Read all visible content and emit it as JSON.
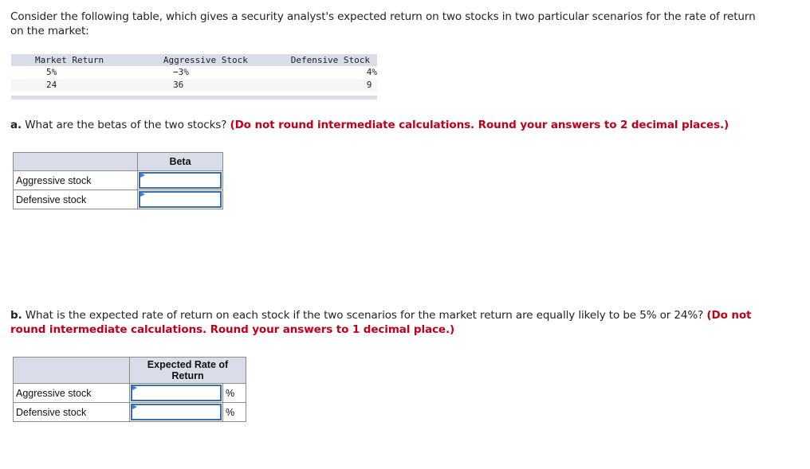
{
  "intro": "Consider the following table, which gives a security analyst's expected return on two stocks in two particular scenarios for the rate of return on the market:",
  "market_table": {
    "headers": [
      "Market Return",
      "Aggressive Stock",
      "Defensive Stock"
    ],
    "rows": [
      [
        "5%",
        "−3%",
        "4%"
      ],
      [
        "24",
        "36",
        "9"
      ]
    ]
  },
  "part_a": {
    "label": "a.",
    "question": " What are the betas of the two stocks? ",
    "instruction": "(Do not round intermediate calculations. Round your answers to 2 decimal places.)",
    "grid": {
      "header_blank": "",
      "header_col": "Beta",
      "rows": [
        {
          "label": "Aggressive stock",
          "value": ""
        },
        {
          "label": "Defensive stock",
          "value": ""
        }
      ]
    }
  },
  "part_b": {
    "label": "b.",
    "question": " What is the expected rate of return on each stock if the two scenarios for the market return are equally likely to be 5% or 24%? ",
    "instruction": "(Do not round intermediate calculations. Round your answers to 1 decimal place.)",
    "grid": {
      "header_blank": "",
      "header_col": "Expected Rate of Return",
      "unit": "%",
      "rows": [
        {
          "label": "Aggressive stock",
          "value": ""
        },
        {
          "label": "Defensive stock",
          "value": ""
        }
      ]
    }
  },
  "colors": {
    "instruction_red": "#c0001a",
    "header_bg": "#d9dde9",
    "input_border": "#3a6ea8"
  }
}
